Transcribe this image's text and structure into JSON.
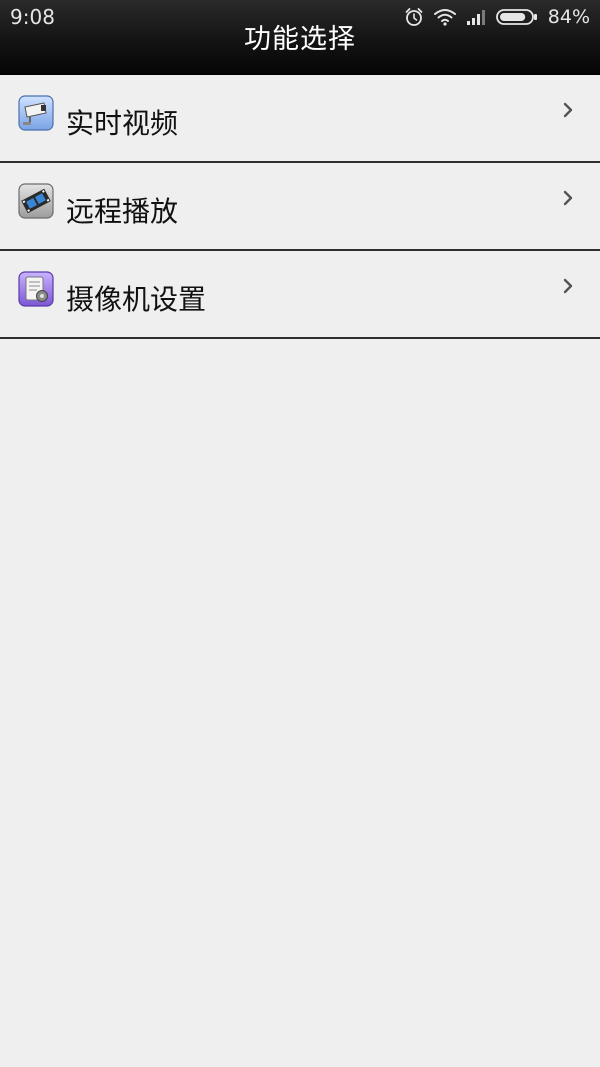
{
  "status_bar": {
    "time": "9:08",
    "battery_percent": "84%",
    "battery_level": 0.84
  },
  "header": {
    "title": "功能选择"
  },
  "menu": {
    "items": [
      {
        "label": "实时视频",
        "icon": "security-camera-icon"
      },
      {
        "label": "远程播放",
        "icon": "film-strip-icon"
      },
      {
        "label": "摄像机设置",
        "icon": "camera-settings-icon"
      }
    ]
  },
  "colors": {
    "background": "#efefef",
    "header": "#141414",
    "divider": "#2e2e2e",
    "text": "#111111"
  }
}
